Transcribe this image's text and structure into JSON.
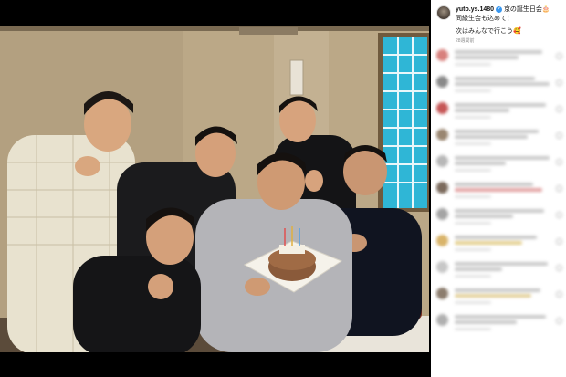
{
  "post": {
    "username": "yuto.ys.1480",
    "caption_line1": "京の誕生日会🎂",
    "caption_line2": "同級生会も込めて！",
    "caption_line3": "次はみんなで行こう🥰",
    "timestamp": "28週間前"
  },
  "icons": {
    "verified": "verified-badge-icon",
    "like": "heart-icon"
  },
  "comments_count_visible": 11,
  "colors": {
    "background": "#000000",
    "panel": "#ffffff",
    "verified": "#3897f0",
    "timestamp": "#8e8e8e"
  }
}
